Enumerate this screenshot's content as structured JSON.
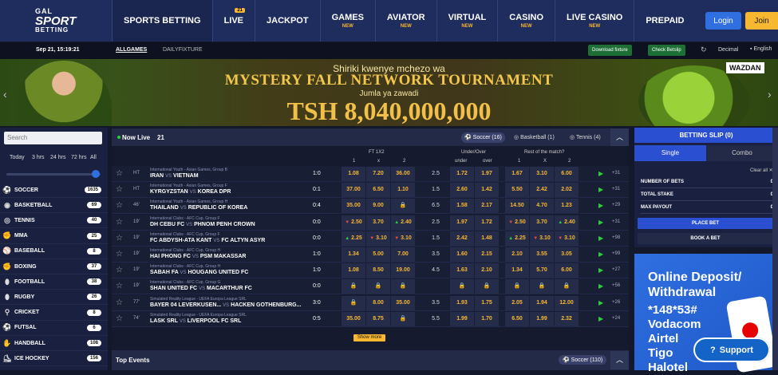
{
  "brand": {
    "line1": "GAL",
    "line2": "SPORT",
    "line3": "BETTING"
  },
  "nav": [
    {
      "label": "SPORTS BETTING",
      "new": "",
      "badge": ""
    },
    {
      "label": "LIVE",
      "new": "",
      "badge": "21"
    },
    {
      "label": "JACKPOT",
      "new": "",
      "badge": ""
    },
    {
      "label": "GAMES",
      "new": "NEW",
      "badge": ""
    },
    {
      "label": "AVIATOR",
      "new": "NEW",
      "badge": ""
    },
    {
      "label": "VIRTUAL",
      "new": "NEW",
      "badge": ""
    },
    {
      "label": "CASINO",
      "new": "NEW",
      "badge": ""
    },
    {
      "label": "LIVE CASINO",
      "new": "NEW",
      "badge": ""
    },
    {
      "label": "PREPAID",
      "new": "",
      "badge": ""
    }
  ],
  "auth": {
    "login": "Login",
    "join": "Join"
  },
  "subbar": {
    "date": "Sep 21, 15:19:21",
    "tab_all": "ALLGAMES",
    "tab_daily": "DAILYFIXTURE",
    "download": "Download fixture",
    "check": "Check Betslip",
    "decimal": "Decimal",
    "lang": "English"
  },
  "banner": {
    "line1": "Shiriki kwenye mchezo wa",
    "line2": "MYSTERY FALL NETWORK TOURNAMENT",
    "line3": "Jumla ya zawadi",
    "line4": "TSH 8,040,000,000",
    "provider": "WAZDAN"
  },
  "sidebar": {
    "search_placeholder": "Search",
    "timeframes": [
      "Today",
      "3 hrs",
      "24 hrs",
      "72 hrs",
      "All"
    ],
    "sports": [
      {
        "name": "SOCCER",
        "count": "1635",
        "icon": "soccer-icon"
      },
      {
        "name": "BASKETBALL",
        "count": "69",
        "icon": "basketball-icon"
      },
      {
        "name": "TENNIS",
        "count": "40",
        "icon": "tennis-icon"
      },
      {
        "name": "MMA",
        "count": "25",
        "icon": "mma-icon"
      },
      {
        "name": "BASEBALL",
        "count": "8",
        "icon": "baseball-icon"
      },
      {
        "name": "BOXING",
        "count": "37",
        "icon": "boxing-icon"
      },
      {
        "name": "FOOTBALL",
        "count": "38",
        "icon": "football-icon"
      },
      {
        "name": "RUGBY",
        "count": "26",
        "icon": "rugby-icon"
      },
      {
        "name": "CRICKET",
        "count": "8",
        "icon": "cricket-icon"
      },
      {
        "name": "FUTSAL",
        "count": "6",
        "icon": "futsal-icon"
      },
      {
        "name": "HANDBALL",
        "count": "108",
        "icon": "handball-icon"
      },
      {
        "name": "ICE HOCKEY",
        "count": "156",
        "icon": "ice-hockey-icon"
      }
    ]
  },
  "live": {
    "title": "Now Live",
    "count": "21",
    "sport_tabs": [
      "Soccer (16)",
      "Basketball (1)",
      "Tennis (4)"
    ],
    "col_groups": [
      "FT 1X2",
      "Under/Over",
      "Rest of the match?"
    ],
    "cols": [
      "1",
      "x",
      "2",
      "under",
      "over",
      "1",
      "X",
      "2"
    ],
    "show_more": "Show more",
    "matches": [
      {
        "min": "HT",
        "league": "International Youth - Asian Games, Group B",
        "home": "IRAN",
        "away": "VIETNAM",
        "score": "1:0",
        "o1": "1.08",
        "ox": "7.20",
        "o2": "36.00",
        "line": "2.5",
        "under": "1.72",
        "over": "1.97",
        "r1": "1.67",
        "rx": "3.10",
        "r2": "6.00",
        "more": "+31"
      },
      {
        "min": "HT",
        "league": "International Youth - Asian Games, Group F",
        "home": "KYRGYZSTAN",
        "away": "KOREA DPR",
        "score": "0:1",
        "o1": "37.00",
        "ox": "6.50",
        "o2": "1.10",
        "line": "1.5",
        "under": "2.60",
        "over": "1.42",
        "r1": "5.50",
        "rx": "2.42",
        "r2": "2.02",
        "more": "+31"
      },
      {
        "min": "46'",
        "league": "International Youth - Asian Games, Group H",
        "home": "THAILAND",
        "away": "REPUBLIC OF KOREA",
        "score": "0:4",
        "o1": "35.00",
        "ox": "9.00",
        "o2": "LOCK",
        "line": "6.5",
        "under": "1.58",
        "over": "2.17",
        "r1": "14.50",
        "rx": "4.70",
        "r2": "1.23",
        "more": "+29"
      },
      {
        "min": "19'",
        "league": "International Clubs - AFC Cup, Group F",
        "home": "DH CEBU FC",
        "away": "PHNOM PENH CROWN",
        "score": "0:0",
        "o1": "DN 2.50",
        "ox": "3.70",
        "o2": "UP 2.40",
        "line": "2.5",
        "under": "1.97",
        "over": "1.72",
        "r1": "DN 2.50",
        "rx": "3.70",
        "r2": "UP 2.40",
        "more": "+31"
      },
      {
        "min": "19'",
        "league": "International Clubs - AFC Cup, Group F",
        "home": "FC ABDYSH-ATA KANT",
        "away": "FC ALTYN ASYR",
        "score": "0:0",
        "o1": "UP 2.25",
        "ox": "DN 3.10",
        "o2": "DN 3.10",
        "line": "1.5",
        "under": "2.42",
        "over": "1.48",
        "r1": "UP 2.25",
        "rx": "DN 3.10",
        "r2": "DN 3.10",
        "more": "+98"
      },
      {
        "min": "19'",
        "league": "International Clubs - AFC Cup, Group H",
        "home": "HAI PHONG FC",
        "away": "PSM MAKASSAR",
        "score": "1:0",
        "o1": "1.34",
        "ox": "5.00",
        "o2": "7.00",
        "line": "3.5",
        "under": "1.60",
        "over": "2.15",
        "r1": "2.10",
        "rx": "3.55",
        "r2": "3.05",
        "more": "+99"
      },
      {
        "min": "19'",
        "league": "International Clubs - AFC Cup, Group H",
        "home": "SABAH FA",
        "away": "HOUGANG UNITED FC",
        "score": "1:0",
        "o1": "1.08",
        "ox": "8.50",
        "o2": "19.00",
        "line": "4.5",
        "under": "1.63",
        "over": "2.10",
        "r1": "1.34",
        "rx": "5.70",
        "r2": "6.00",
        "more": "+27"
      },
      {
        "min": "19'",
        "league": "International Clubs - AFC Cup, Group G",
        "home": "SHAN UNITED FC",
        "away": "MACARTHUR FC",
        "score": "0:0",
        "o1": "LOCK",
        "ox": "LOCK",
        "o2": "LOCK",
        "line": "",
        "under": "LOCK",
        "over": "LOCK",
        "r1": "LOCK",
        "rx": "LOCK",
        "r2": "LOCK",
        "more": "+56"
      },
      {
        "min": "77'",
        "league": "Simulated Reality League - UEFA Europa League SRL",
        "home": "BAYER 04 LEVERKUSEN...",
        "away": "HACKEN GOTHENBURG...",
        "score": "3:0",
        "o1": "LOCK",
        "ox": "8.00",
        "o2": "35.00",
        "line": "3.5",
        "under": "1.93",
        "over": "1.75",
        "r1": "2.05",
        "rx": "1.94",
        "r2": "12.00",
        "more": "+26"
      },
      {
        "min": "74'",
        "league": "Simulated Reality League - UEFA Europa League SRL",
        "home": "LASK SRL",
        "away": "LIVERPOOL FC SRL",
        "score": "0:5",
        "o1": "35.00",
        "ox": "8.75",
        "o2": "LOCK",
        "line": "5.5",
        "under": "1.99",
        "over": "1.70",
        "r1": "6.50",
        "rx": "1.99",
        "r2": "2.32",
        "more": "+24"
      }
    ]
  },
  "top_events": {
    "title": "Top Events",
    "sport": "Soccer (110)"
  },
  "slip": {
    "title": "BETTING SLIP (0)",
    "tab_single": "Single",
    "tab_combo": "Combo",
    "clear": "Clear all",
    "num_bets_label": "NUMBER OF BETS",
    "num_bets": "0",
    "total_stake_label": "TOTAL STAKE",
    "total_stake": "0",
    "max_payout_label": "MAX PAYOUT",
    "max_payout": "0",
    "place": "PLACE BET",
    "book": "BOOK A BET"
  },
  "promo": {
    "title1": "Online Deposit/",
    "title2": "Withdrawal",
    "code": "*148*53#",
    "p1": "Vodacom",
    "p2": "Airtel",
    "p3": "Tigo",
    "p4": "Halotel"
  },
  "support": "Support"
}
